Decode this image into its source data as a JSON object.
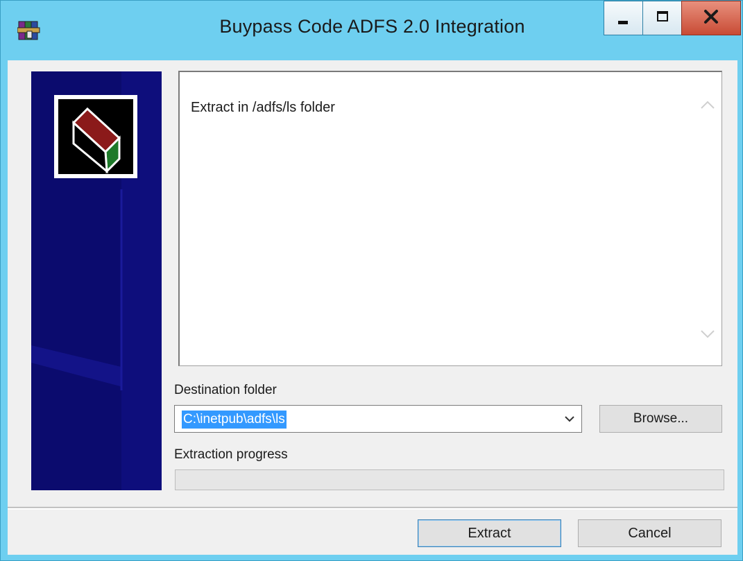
{
  "window": {
    "title": "Buypass Code ADFS 2.0 Integration",
    "app_icon": "winrar-books-icon"
  },
  "titlebar_buttons": {
    "minimize": "minimize-icon",
    "maximize": "maximize-icon",
    "close": "close-icon"
  },
  "info": {
    "text": "Extract in /adfs/ls folder"
  },
  "destination": {
    "label": "Destination folder",
    "value": "C:\\inetpub\\adfs\\ls",
    "browse_label": "Browse..."
  },
  "progress": {
    "label": "Extraction progress",
    "percent": 0
  },
  "footer": {
    "extract_label": "Extract",
    "cancel_label": "Cancel"
  },
  "colors": {
    "titlebar": "#6ecff0",
    "sidebar": "#0b0b6e",
    "selection": "#3399ff",
    "close": "#c84b35"
  }
}
